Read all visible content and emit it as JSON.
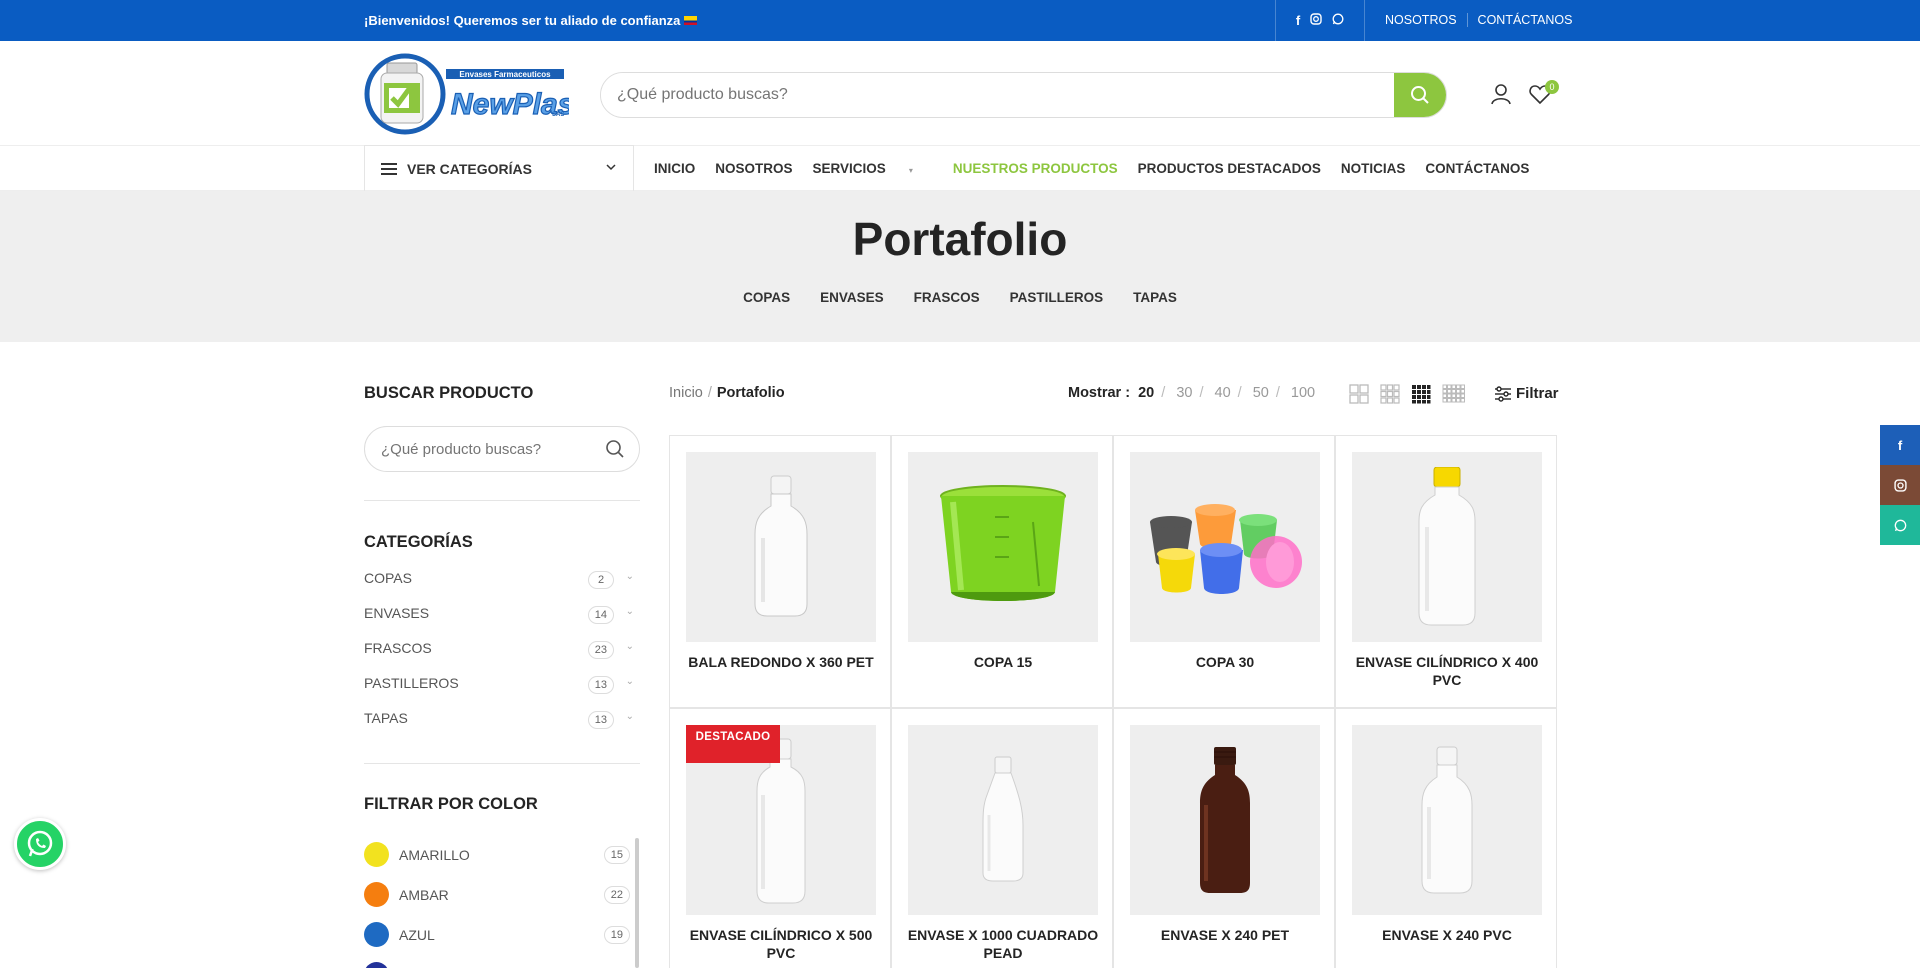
{
  "topbar": {
    "welcome": "¡Bienvenidos! Queremos ser tu aliado de confianza",
    "links": [
      "NOSOTROS",
      "CONTÁCTANOS"
    ]
  },
  "header": {
    "search_placeholder": "¿Qué producto buscas?",
    "wishlist_count": "0"
  },
  "nav": {
    "categories_label": "VER CATEGORÍAS",
    "items": [
      "INICIO",
      "NOSOTROS",
      "SERVICIOS",
      "NUESTROS PRODUCTOS",
      "PRODUCTOS DESTACADOS",
      "NOTICIAS",
      "CONTÁCTANOS"
    ],
    "active": "NUESTROS PRODUCTOS"
  },
  "hero": {
    "title": "Portafolio",
    "categories": [
      "COPAS",
      "ENVASES",
      "FRASCOS",
      "PASTILLEROS",
      "TAPAS"
    ]
  },
  "sidebar": {
    "search_title": "BUSCAR PRODUCTO",
    "search_placeholder": "¿Qué producto buscas?",
    "categories_title": "CATEGORÍAS",
    "categories": [
      {
        "label": "COPAS",
        "count": "2"
      },
      {
        "label": "ENVASES",
        "count": "14"
      },
      {
        "label": "FRASCOS",
        "count": "23"
      },
      {
        "label": "PASTILLEROS",
        "count": "13"
      },
      {
        "label": "TAPAS",
        "count": "13"
      }
    ],
    "color_title": "FILTRAR POR COLOR",
    "colors": [
      {
        "label": "AMARILLO",
        "count": "15",
        "hex": "#f2e21f"
      },
      {
        "label": "AMBAR",
        "count": "22",
        "hex": "#f57e0f"
      },
      {
        "label": "AZUL",
        "count": "19",
        "hex": "#1e6ac2"
      }
    ]
  },
  "toolbar": {
    "breadcrumb_home": "Inicio",
    "breadcrumb_current": "Portafolio",
    "show_label": "Mostrar :",
    "show_options": [
      "20",
      "30",
      "40",
      "50",
      "100"
    ],
    "show_selected": "20",
    "filter_label": "Filtrar"
  },
  "products": [
    {
      "name": "BALA REDONDO X 360 PET",
      "image": "white-round-bottle"
    },
    {
      "name": "COPA 15",
      "image": "green-measuring-cup"
    },
    {
      "name": "COPA 30",
      "image": "colored-cups"
    },
    {
      "name": "ENVASE CILÍNDRICO X 400 PVC",
      "image": "white-bottle-yellow-cap"
    },
    {
      "name": "ENVASE CILÍNDRICO X 500 PVC",
      "image": "white-cylinder-bottle",
      "badge": "DESTACADO"
    },
    {
      "name": "ENVASE X 1000 CUADRADO PEAD",
      "image": "white-flat-bottle"
    },
    {
      "name": "ENVASE X 240 PET",
      "image": "amber-bottle"
    },
    {
      "name": "ENVASE X 240 PVC",
      "image": "white-bottle"
    }
  ],
  "colors": {
    "topbar": "#0a5cc2",
    "accent": "#8dc63f",
    "badge": "#e0222a",
    "facebook": "#1d5fb8",
    "instagram": "#7b4a36",
    "whatsapp": "#1fb89a"
  }
}
